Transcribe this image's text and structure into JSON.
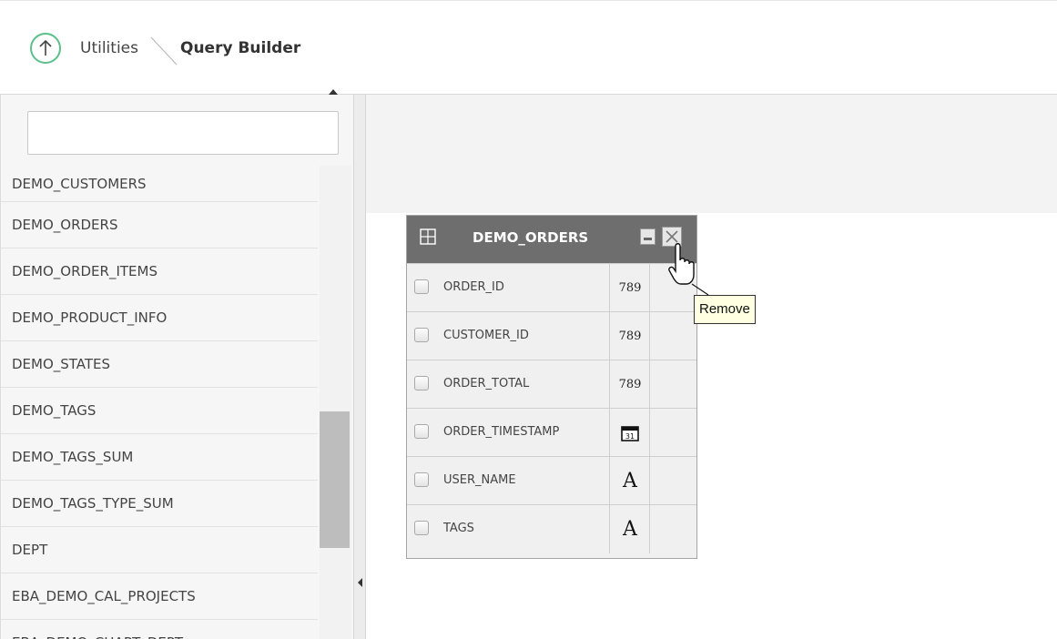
{
  "header": {
    "breadcrumb_parent": "Utilities",
    "breadcrumb_current": "Query Builder"
  },
  "sidebar": {
    "search_value": "",
    "items": [
      {
        "label": "DEMO_CUSTOMERS"
      },
      {
        "label": "DEMO_ORDERS"
      },
      {
        "label": "DEMO_ORDER_ITEMS"
      },
      {
        "label": "DEMO_PRODUCT_INFO"
      },
      {
        "label": "DEMO_STATES"
      },
      {
        "label": "DEMO_TAGS"
      },
      {
        "label": "DEMO_TAGS_SUM"
      },
      {
        "label": "DEMO_TAGS_TYPE_SUM"
      },
      {
        "label": "DEPT"
      },
      {
        "label": "EBA_DEMO_CAL_PROJECTS"
      },
      {
        "label": "EBA_DEMO_CHART_DEPT"
      }
    ]
  },
  "table_widget": {
    "title": "DEMO_ORDERS",
    "columns": [
      {
        "name": "ORDER_ID",
        "type": "789",
        "type_icon": "number-icon"
      },
      {
        "name": "CUSTOMER_ID",
        "type": "789",
        "type_icon": "number-icon"
      },
      {
        "name": "ORDER_TOTAL",
        "type": "789",
        "type_icon": "number-icon"
      },
      {
        "name": "ORDER_TIMESTAMP",
        "type": "31",
        "type_icon": "calendar-icon"
      },
      {
        "name": "USER_NAME",
        "type": "A",
        "type_icon": "text-icon"
      },
      {
        "name": "TAGS",
        "type": "A",
        "type_icon": "text-icon"
      }
    ]
  },
  "tooltip": {
    "text": "Remove"
  },
  "colors": {
    "accent_green": "#5cbf8a",
    "table_header": "#6e6e6e",
    "tooltip_bg": "#ffffe1"
  }
}
